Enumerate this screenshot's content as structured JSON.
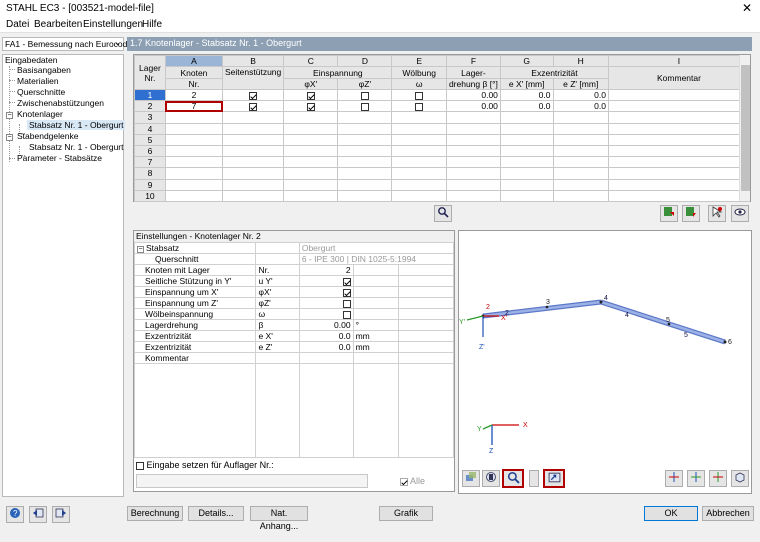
{
  "window": {
    "title": "STAHL EC3 - [003521-model-file]",
    "close": "✕"
  },
  "menu": [
    "Datei",
    "Bearbeiten",
    "Einstellungen",
    "Hilfe"
  ],
  "case_selector": {
    "value": "FA1 - Bemessung nach Eurocod",
    "arrow": "⌄"
  },
  "nav": {
    "items": [
      {
        "label": "Eingabedaten"
      },
      {
        "label": "Basisangaben"
      },
      {
        "label": "Materialien"
      },
      {
        "label": "Querschnitte"
      },
      {
        "label": "Zwischenabstützungen"
      },
      {
        "label": "Knotenlager"
      },
      {
        "label": "Stabsatz Nr. 1 - Obergurt"
      },
      {
        "label": "Stabendgelenke"
      },
      {
        "label": "Stabsatz Nr. 1 - Obergurt"
      },
      {
        "label": "Parameter - Stabsätze"
      }
    ],
    "expander": "−"
  },
  "section_title": "1.7 Knotenlager - Stabsatz Nr. 1 - Obergurt",
  "table": {
    "col_letters": [
      "A",
      "B",
      "C",
      "D",
      "E",
      "F",
      "G",
      "H",
      "I"
    ],
    "head_lager": "Lager",
    "head_nr": "Nr.",
    "head_knoten": "Knoten",
    "head_knoten_nr": "Nr.",
    "head_seiten": "Seitenstützung",
    "head_einsp": "Einspannung",
    "head_woelb": "Wölbung",
    "head_drehung1": "Lager-",
    "head_drehung2": "drehung β [°]",
    "head_exz": "Exzentrizität",
    "head_uy": "u Y'",
    "head_phix": "φX'",
    "head_phiz": "φZ'",
    "head_omega": "ω",
    "head_ex": "e X' [mm]",
    "head_ez": "e Z' [mm]",
    "head_kommentar": "Kommentar",
    "rows": [
      {
        "nr": "1",
        "knoten": "2",
        "uy": true,
        "phix": true,
        "phiz": false,
        "omega": false,
        "beta": "0.00",
        "ex": "0.0",
        "ez": "0.0",
        "kommentar": ""
      },
      {
        "nr": "2",
        "knoten": "7",
        "uy": true,
        "phix": true,
        "phiz": false,
        "omega": false,
        "beta": "0.00",
        "ex": "0.0",
        "ez": "0.0",
        "kommentar": ""
      },
      {
        "nr": "3"
      },
      {
        "nr": "4"
      },
      {
        "nr": "5"
      },
      {
        "nr": "6"
      },
      {
        "nr": "7"
      },
      {
        "nr": "8"
      },
      {
        "nr": "9"
      },
      {
        "nr": "10"
      }
    ]
  },
  "settings": {
    "title": "Einstellungen - Knotenlager Nr. 2",
    "group_label": "Stabsatz",
    "group_value": "Obergurt",
    "querschnitt_label": "Querschnitt",
    "querschnitt_value": "6 - IPE 300 | DIN 1025-5:1994",
    "rows": [
      {
        "label": "Knoten mit Lager",
        "sym": "Nr.",
        "value": "2",
        "unit": ""
      },
      {
        "label": "Seitliche Stützung in Y'",
        "sym": "u Y'",
        "check": true,
        "unit": ""
      },
      {
        "label": "Einspannung um X'",
        "sym": "φX'",
        "check": true,
        "unit": ""
      },
      {
        "label": "Einspannung um Z'",
        "sym": "φZ'",
        "check": false,
        "unit": ""
      },
      {
        "label": "Wölbeinspannung",
        "sym": "ω",
        "check": false,
        "unit": ""
      },
      {
        "label": "Lagerdrehung",
        "sym": "β",
        "value": "0.00",
        "unit": "°"
      },
      {
        "label": "Exzentrizität",
        "sym": "e X'",
        "value": "0.0",
        "unit": "mm"
      },
      {
        "label": "Exzentrizität",
        "sym": "e Z'",
        "value": "0.0",
        "unit": "mm"
      },
      {
        "label": "Kommentar",
        "sym": "",
        "value": "",
        "unit": ""
      }
    ],
    "apply_label": "Eingabe setzen für Auflager Nr.:",
    "alle_label": "Alle"
  },
  "graphic": {
    "node_labels": [
      "2",
      "2",
      "3",
      "4",
      "4",
      "5",
      "5",
      "6"
    ],
    "axis_x": "X'",
    "axis_y": "Y'",
    "axis_z": "Z'",
    "mini_x": "X",
    "mini_y": "Y",
    "mini_z": "Z"
  },
  "buttons": {
    "berechnung": "Berechnung",
    "details": "Details...",
    "nat_anhang": "Nat. Anhang...",
    "grafik": "Grafik",
    "ok": "OK",
    "abbrechen": "Abbrechen"
  },
  "colors": {
    "header_blue": "#8c9fb3",
    "selected_col": "#9bb5d6",
    "member": "#7b96d8",
    "highlight_red": "#b00000"
  }
}
